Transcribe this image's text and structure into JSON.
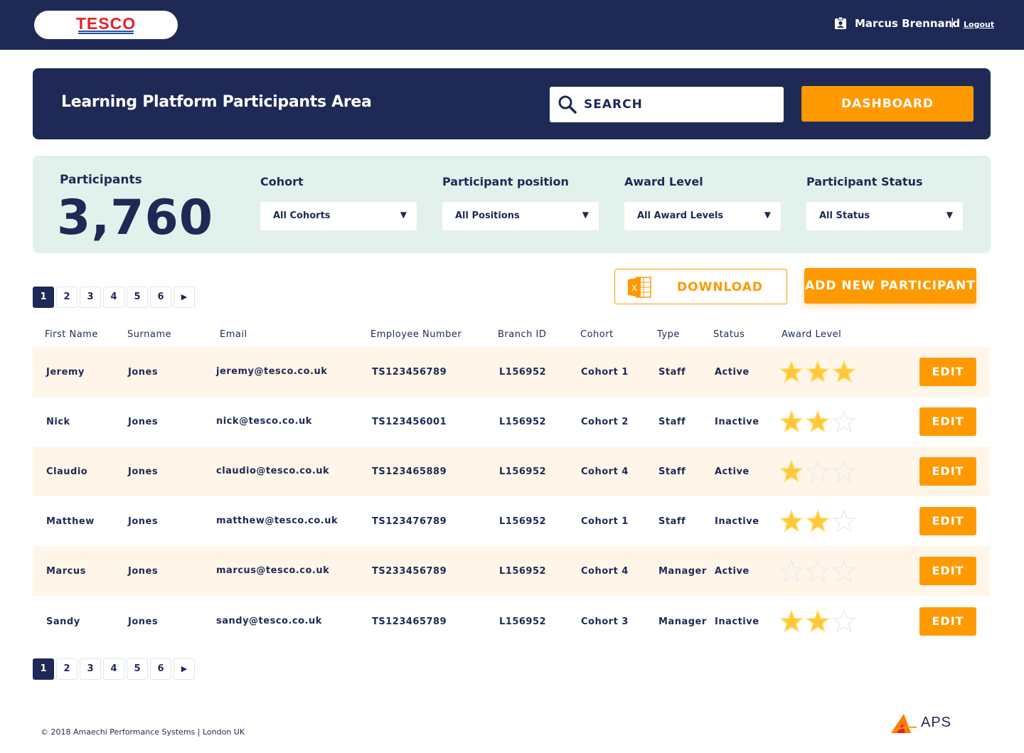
{
  "brand": {
    "logo_text": "TESCO",
    "primary_color": "#1e2a55",
    "accent_color": "#ff9900",
    "logo_red": "#e4202c"
  },
  "topbar": {
    "user_name": "Marcus Brennand",
    "separator": "|",
    "logout_label": "Logout",
    "user_icon": "user-badge-icon"
  },
  "header": {
    "title": "Learning Platform Participants Area",
    "search_placeholder": "SEARCH",
    "dashboard_label": "DASHBOARD"
  },
  "filters": {
    "participants_label": "Participants",
    "participants_count": "3,760",
    "items": [
      {
        "label": "Cohort",
        "value": "All Cohorts"
      },
      {
        "label": "Participant position",
        "value": "All Positions"
      },
      {
        "label": "Award Level",
        "value": "All Award Levels"
      },
      {
        "label": "Participant Status",
        "value": "All Status"
      }
    ],
    "dropdown_arrow": "▼"
  },
  "pagination": {
    "pages": [
      "1",
      "2",
      "3",
      "4",
      "5",
      "6"
    ],
    "next": "▶",
    "current": "1"
  },
  "actions": {
    "download_label": "DOWNLOAD",
    "add_label": "ADD NEW PARTICIPANT",
    "excel_icon_letter": "X"
  },
  "table": {
    "headers": [
      "First Name",
      "Surname",
      "Email",
      "Employee Number",
      "Branch ID",
      "Cohort",
      "Type",
      "Status",
      "Award Level"
    ],
    "edit_label": "EDIT",
    "max_stars": 3,
    "rows": [
      {
        "first": "Jeremy",
        "surname": "Jones",
        "email": "jeremy@tesco.co.uk",
        "employee": "TS123456789",
        "branch": "L156952",
        "cohort": "Cohort 1",
        "type": "Staff",
        "status": "Active",
        "stars": 3
      },
      {
        "first": "Nick",
        "surname": "Jones",
        "email": "nick@tesco.co.uk",
        "employee": "TS123456001",
        "branch": "L156952",
        "cohort": "Cohort 2",
        "type": "Staff",
        "status": "Inactive",
        "stars": 2
      },
      {
        "first": "Claudio",
        "surname": "Jones",
        "email": "claudio@tesco.co.uk",
        "employee": "TS123465889",
        "branch": "L156952",
        "cohort": "Cohort 4",
        "type": "Staff",
        "status": "Active",
        "stars": 1
      },
      {
        "first": "Matthew",
        "surname": "Jones",
        "email": "matthew@tesco.co.uk",
        "employee": "TS123476789",
        "branch": "L156952",
        "cohort": "Cohort 1",
        "type": "Staff",
        "status": "Inactive",
        "stars": 2
      },
      {
        "first": "Marcus",
        "surname": "Jones",
        "email": "marcus@tesco.co.uk",
        "employee": "TS233456789",
        "branch": "L156952",
        "cohort": "Cohort 4",
        "type": "Manager",
        "status": "Active",
        "stars": 0
      },
      {
        "first": "Sandy",
        "surname": "Jones",
        "email": "sandy@tesco.co.uk",
        "employee": "TS123465789",
        "branch": "L156952",
        "cohort": "Cohort 3",
        "type": "Manager",
        "status": "Inactive",
        "stars": 2
      }
    ]
  },
  "footer": {
    "copyright": "© 2018 Amaechi Performance Systems | London UK",
    "aps_logo_text": "APS"
  }
}
